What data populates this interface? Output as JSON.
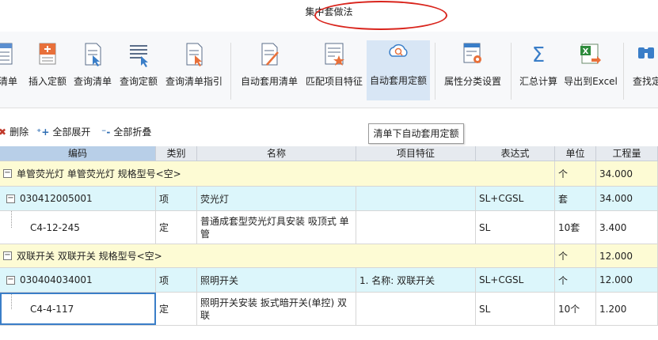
{
  "window": {
    "title": "集中套做法"
  },
  "ribbon": {
    "buttons": [
      {
        "label": "清单",
        "icon": "list-icon"
      },
      {
        "label": "插入定额",
        "icon": "insert-quota-icon"
      },
      {
        "label": "查询清单",
        "icon": "query-list-icon"
      },
      {
        "label": "查询定额",
        "icon": "query-quota-icon"
      },
      {
        "label": "查询清单指引",
        "icon": "query-guide-icon"
      },
      {
        "label": "自动套用清单",
        "icon": "auto-apply-list-icon"
      },
      {
        "label": "匹配项目特征",
        "icon": "match-feature-icon"
      },
      {
        "label": "自动套用定额",
        "icon": "auto-apply-quota-icon"
      },
      {
        "label": "属性分类设置",
        "icon": "attribute-settings-icon"
      },
      {
        "label": "汇总计算",
        "icon": "sum-icon"
      },
      {
        "label": "导出到Excel",
        "icon": "excel-export-icon"
      },
      {
        "label": "查找定",
        "icon": "find-icon"
      }
    ]
  },
  "tooltip": {
    "text": "清单下自动套用定额"
  },
  "toolbar": {
    "delete": "删除",
    "expand_all": "全部展开",
    "collapse_all": "全部折叠"
  },
  "table": {
    "columns": [
      "编码",
      "类别",
      "名称",
      "项目特征",
      "表达式",
      "单位",
      "工程量"
    ],
    "rows": [
      {
        "type": "group",
        "code": "单管荧光灯 单管荧光灯 规格型号<空>",
        "unit": "个",
        "qty": "34.000"
      },
      {
        "type": "item",
        "code": "030412005001",
        "category": "项",
        "name": "荧光灯",
        "feature": "",
        "expr": "SL+CGSL",
        "unit": "套",
        "qty": "34.000"
      },
      {
        "type": "quota",
        "code": "C4-12-245",
        "category": "定",
        "name": "普通成套型荧光灯具安装 吸顶式 单管",
        "feature": "",
        "expr": "SL",
        "unit": "10套",
        "qty": "3.400"
      },
      {
        "type": "group",
        "code": "双联开关 双联开关 规格型号<空>",
        "unit": "个",
        "qty": "12.000"
      },
      {
        "type": "item",
        "code": "030404034001",
        "category": "项",
        "name": "照明开关",
        "feature": "1. 名称: 双联开关",
        "expr": "SL+CGSL",
        "unit": "个",
        "qty": "12.000"
      },
      {
        "type": "quota",
        "code": "C4-4-117",
        "category": "定",
        "name": "照明开关安装 扳式暗开关(单控) 双联",
        "feature": "",
        "expr": "SL",
        "unit": "10个",
        "qty": "1.200"
      }
    ]
  },
  "colors": {
    "group_row": "#fdfbd4",
    "item_row": "#dcf6fb",
    "highlight_ellipse": "#d9241c",
    "active_button": "#d8e6f5"
  }
}
